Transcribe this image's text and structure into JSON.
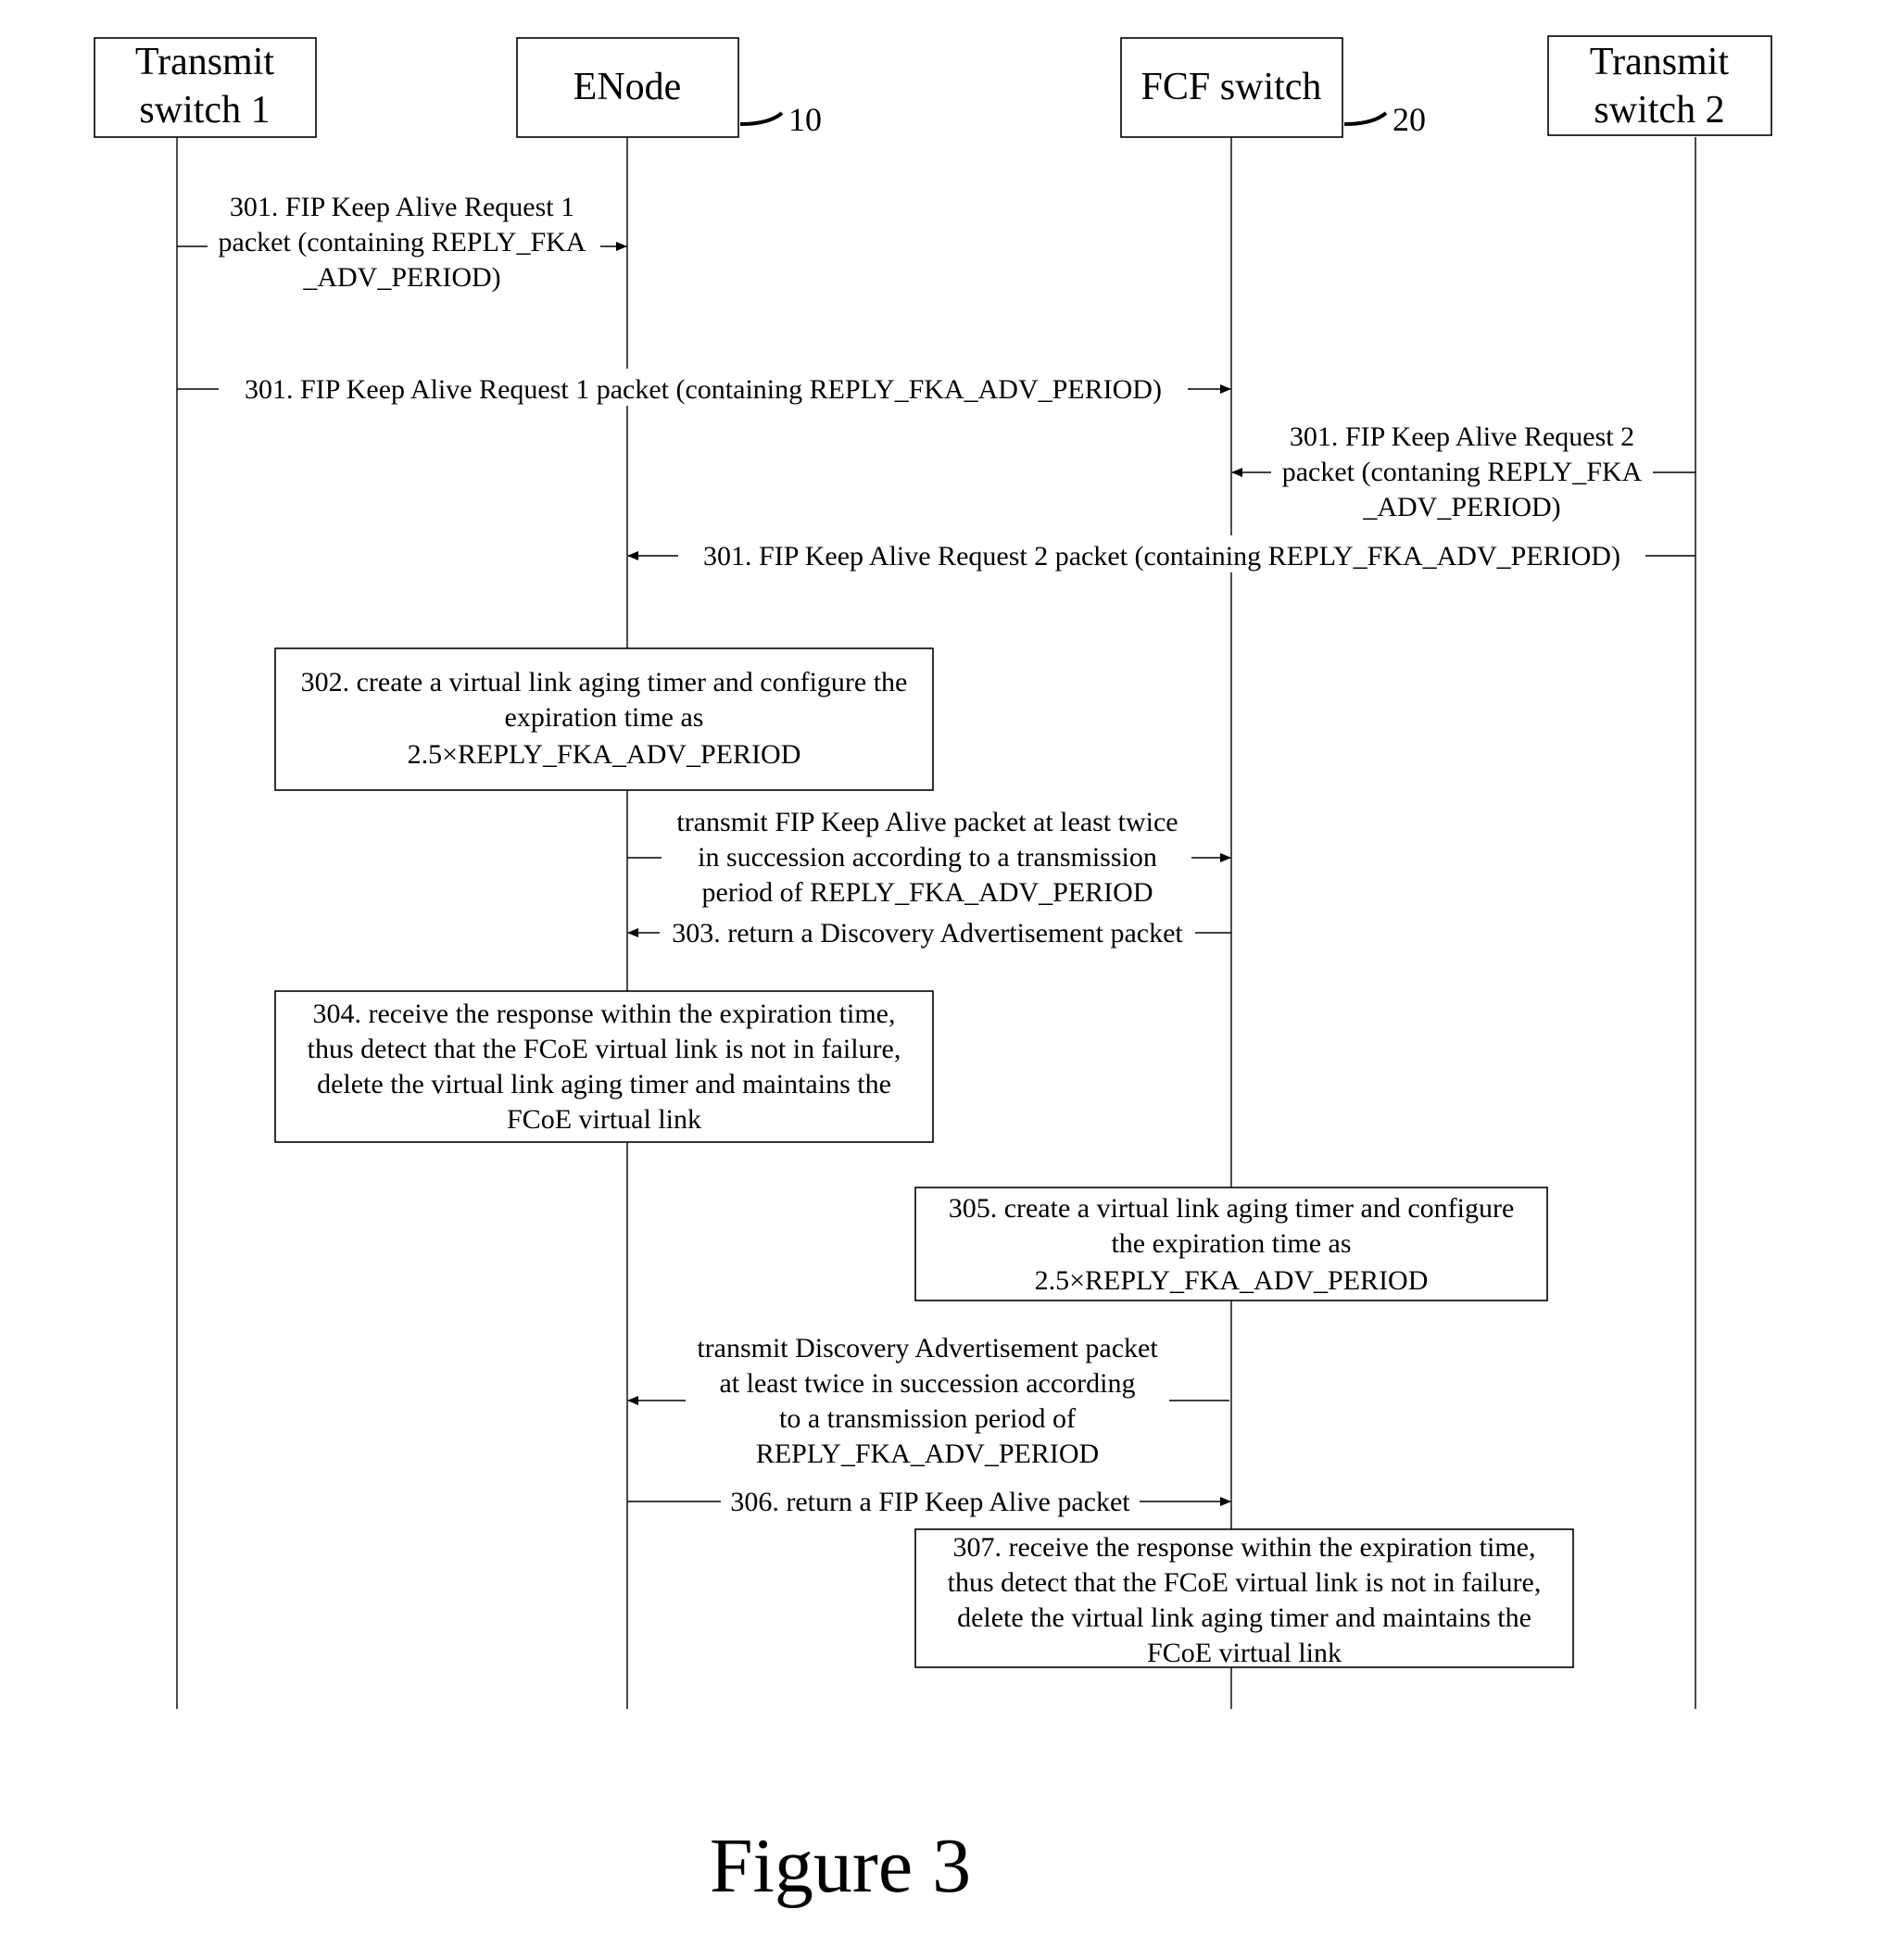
{
  "figure_caption": "Figure 3",
  "participants": [
    {
      "id": "transmit-switch-1",
      "lines": [
        "Transmit",
        "switch 1"
      ],
      "ref": ""
    },
    {
      "id": "enode",
      "lines": [
        "ENode"
      ],
      "ref": "10"
    },
    {
      "id": "fcf-switch",
      "lines": [
        "FCF switch"
      ],
      "ref": "20"
    },
    {
      "id": "transmit-switch-2",
      "lines": [
        "Transmit",
        "switch 2"
      ],
      "ref": ""
    }
  ],
  "messages": [
    {
      "from": 0,
      "to": 1,
      "lines": [
        "301. FIP Keep Alive Request 1",
        "packet (containing REPLY_FKA",
        "_ADV_PERIOD)"
      ]
    },
    {
      "from": 0,
      "to": 2,
      "lines": [
        "301. FIP Keep Alive Request 1 packet (containing REPLY_FKA_ADV_PERIOD)"
      ]
    },
    {
      "from": 3,
      "to": 2,
      "lines": [
        "301. FIP Keep Alive Request 2",
        "packet (contaning REPLY_FKA",
        "_ADV_PERIOD)"
      ]
    },
    {
      "from": 3,
      "to": 1,
      "lines": [
        "301. FIP Keep Alive Request 2 packet (containing REPLY_FKA_ADV_PERIOD)"
      ]
    },
    {
      "from": 1,
      "to": 2,
      "lines": [
        "transmit FIP Keep Alive packet at least twice",
        "in succession according to a transmission",
        "period of REPLY_FKA_ADV_PERIOD"
      ]
    },
    {
      "from": 2,
      "to": 1,
      "lines": [
        "303. return a Discovery Advertisement packet"
      ]
    },
    {
      "from": 2,
      "to": 1,
      "lines": [
        "transmit Discovery Advertisement packet",
        "at least twice in succession according",
        "to a transmission period of",
        "REPLY_FKA_ADV_PERIOD"
      ]
    },
    {
      "from": 1,
      "to": 2,
      "lines": [
        "306. return a FIP Keep Alive packet"
      ]
    }
  ],
  "notes": [
    {
      "step": "302",
      "lines": [
        "302. create a virtual link aging timer and configure the",
        "expiration time as",
        "2.5×REPLY_FKA_ADV_PERIOD"
      ]
    },
    {
      "step": "304",
      "lines": [
        "304. receive the response within the expiration time,",
        "thus detect that the FCoE virtual link is not in failure,",
        "delete the virtual link aging timer and maintains the",
        "FCoE virtual link"
      ]
    },
    {
      "step": "305",
      "lines": [
        "305. create a virtual link aging timer and configure",
        "the expiration time as",
        "2.5×REPLY_FKA_ADV_PERIOD"
      ]
    },
    {
      "step": "307",
      "lines": [
        "307.  receive the response within the expiration time,",
        "thus detect that the FCoE virtual link is not in failure,",
        "delete the virtual link aging timer and maintains the",
        "FCoE virtual link"
      ]
    }
  ]
}
